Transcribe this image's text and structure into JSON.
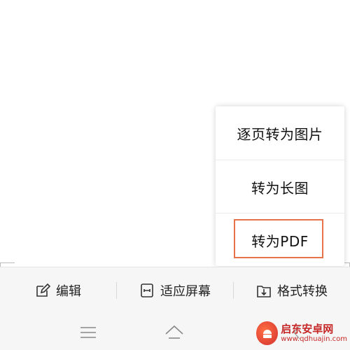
{
  "popup_menu": {
    "items": [
      {
        "label": "逐页转为图片"
      },
      {
        "label": "转为长图"
      },
      {
        "label": "转为PDF",
        "highlighted": true
      }
    ],
    "highlight_color": "#e8734a"
  },
  "toolbar": {
    "edit_label": "编辑",
    "fit_screen_label": "适应屏幕",
    "convert_format_label": "格式转换"
  },
  "navbar": {
    "icons": [
      "menu-icon",
      "home-icon",
      "back-icon"
    ]
  },
  "watermark": {
    "title": "启东安卓网",
    "url": "www.qdhuajin.com"
  }
}
